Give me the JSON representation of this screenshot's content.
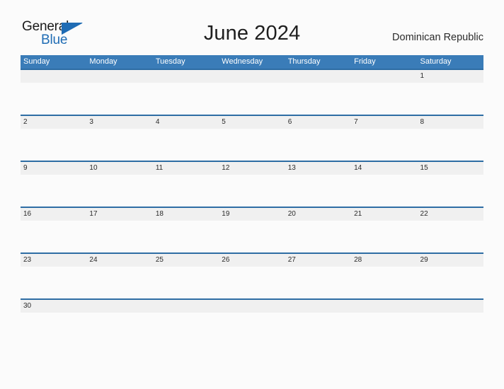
{
  "logo": {
    "word1": "General",
    "word2": "Blue",
    "triangle_icon": "triangle-flag-icon",
    "accent_color": "#1f6cb4"
  },
  "header": {
    "title": "June 2024",
    "region": "Dominican Republic"
  },
  "colors": {
    "header_blue": "#3a7cb8",
    "rule_blue": "#2e6da4",
    "date_band_gray": "#f0f0f0",
    "page_background": "#fbfbfb",
    "text_dark": "#1a1a1a"
  },
  "calendar": {
    "weekdays": [
      "Sunday",
      "Monday",
      "Tuesday",
      "Wednesday",
      "Thursday",
      "Friday",
      "Saturday"
    ],
    "weeks": [
      [
        "",
        "",
        "",
        "",
        "",
        "",
        "1"
      ],
      [
        "2",
        "3",
        "4",
        "5",
        "6",
        "7",
        "8"
      ],
      [
        "9",
        "10",
        "11",
        "12",
        "13",
        "14",
        "15"
      ],
      [
        "16",
        "17",
        "18",
        "19",
        "20",
        "21",
        "22"
      ],
      [
        "23",
        "24",
        "25",
        "26",
        "27",
        "28",
        "29"
      ],
      [
        "30",
        "",
        "",
        "",
        "",
        "",
        ""
      ]
    ]
  }
}
